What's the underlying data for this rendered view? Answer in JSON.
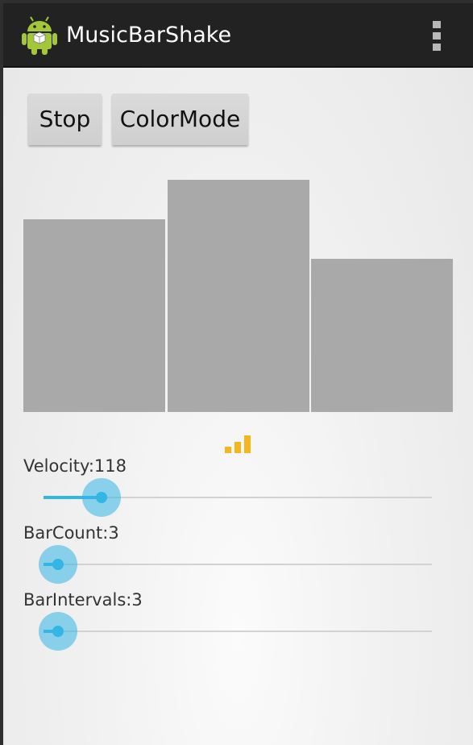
{
  "actionbar": {
    "title": "MusicBarShake",
    "app_icon": "android-robot-icon",
    "overflow_icon": "overflow-menu-icon"
  },
  "buttons": {
    "stop_label": "Stop",
    "colormode_label": "ColorMode"
  },
  "visualizer": {
    "bar_color": "#a9a9a9",
    "bar_levels": [
      0.83,
      1.0,
      0.66
    ]
  },
  "loading_icon": "signal-bars-icon",
  "sliders": [
    {
      "label": "Velocity:118",
      "value_fraction": 0.12
    },
    {
      "label": "BarCount:3",
      "value_fraction": 0.0
    },
    {
      "label": "BarIntervals:3",
      "value_fraction": 0.0
    }
  ],
  "colors": {
    "accent": "#33b5e5",
    "actionbar": "#222222",
    "loading": "#f5b51c"
  }
}
